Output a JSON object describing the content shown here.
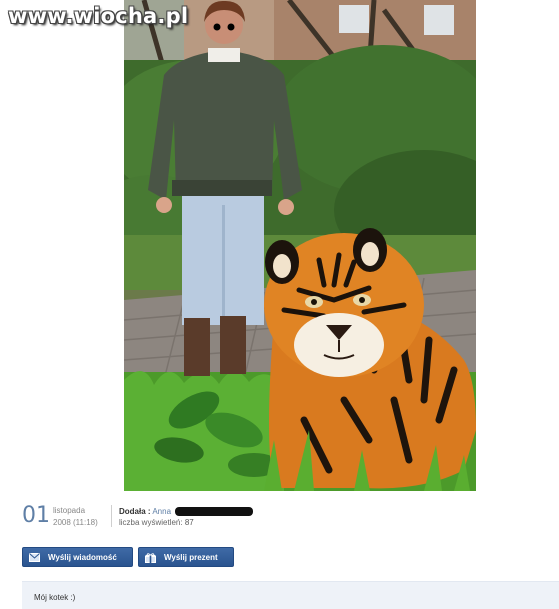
{
  "watermark": "www.wiocha.pl",
  "post": {
    "day": "01",
    "month": "listopada",
    "datetime": "2008 (11:18)",
    "added_by_label": "Dodała :",
    "author": "Anna",
    "views_label": "liczba wyświetleń:",
    "views_count": "87"
  },
  "actions": {
    "send_message": "Wyślij wiadomość",
    "send_gift": "Wyślij prezent"
  },
  "comment": {
    "text": "Mój kotek :)"
  },
  "colors": {
    "accent_blue": "#2f5d9c",
    "date_blue": "#5f7fa6",
    "comment_bg": "#eef2f8"
  },
  "icons": [
    "envelope-icon",
    "gift-icon"
  ]
}
